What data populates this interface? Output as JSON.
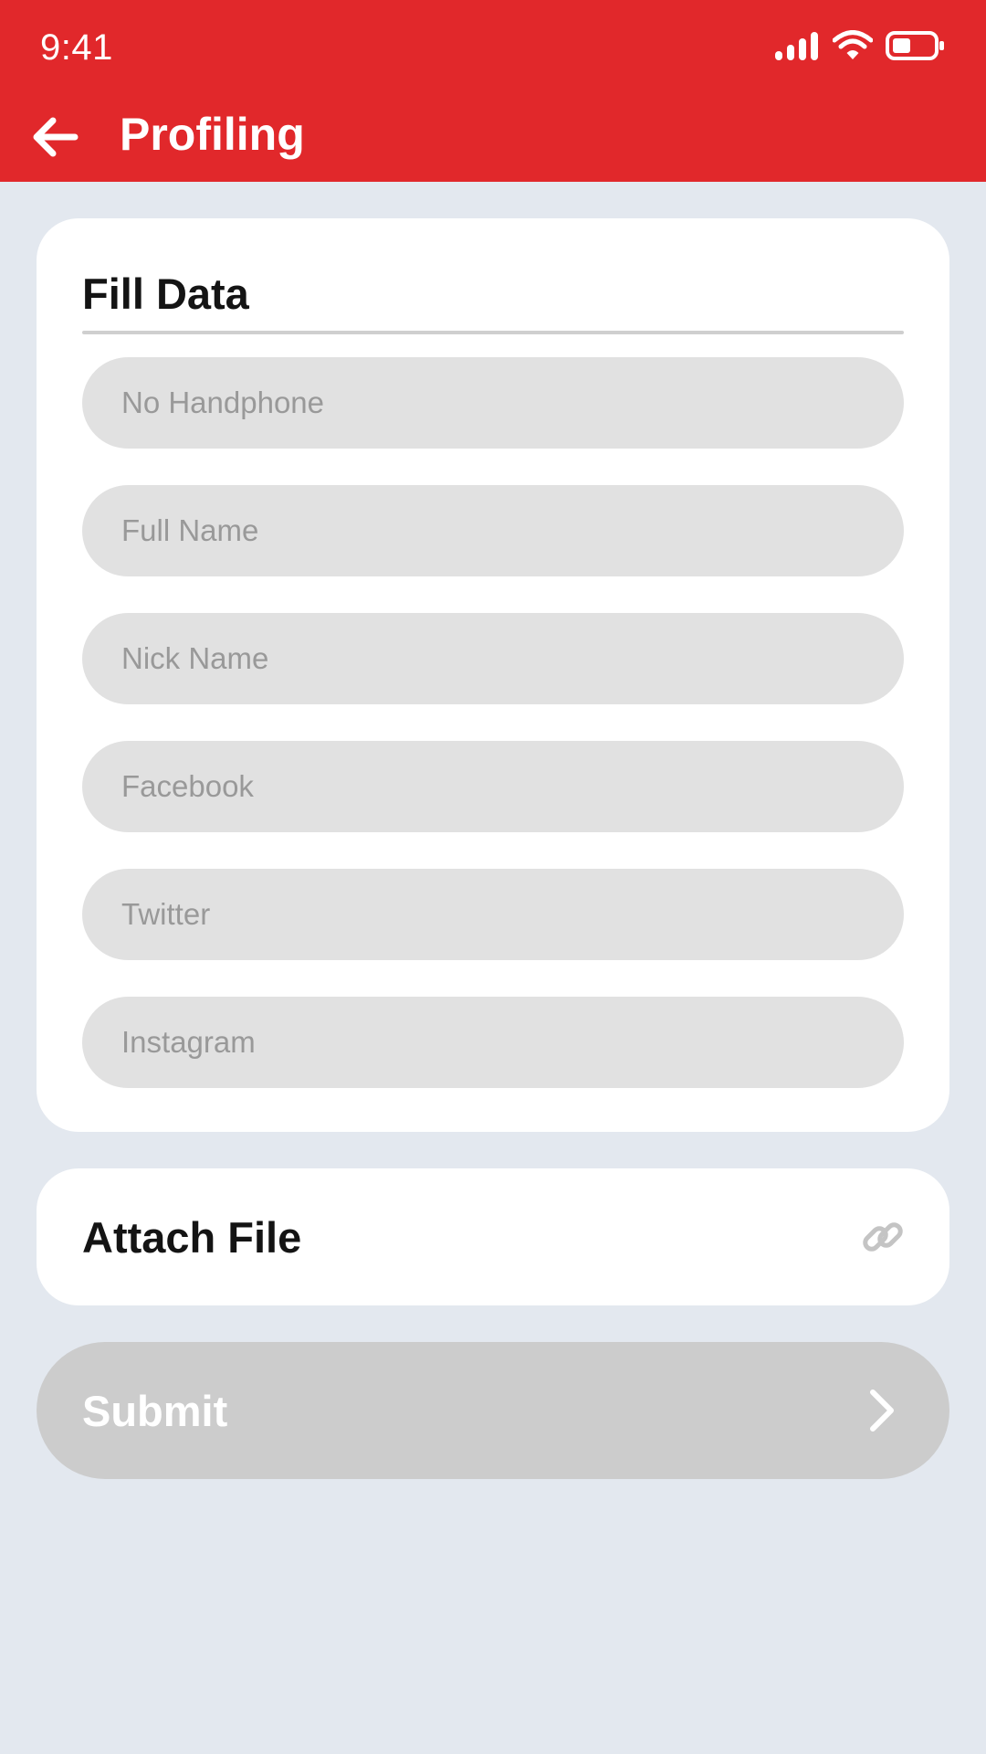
{
  "status_bar": {
    "time": "9:41",
    "icons": [
      "signal-icon",
      "wifi-icon",
      "battery-icon"
    ],
    "battery_level": 0.45
  },
  "app_bar": {
    "title": "Profiling",
    "back_icon": "arrow-left-icon",
    "color": "#e1282b"
  },
  "fill_data": {
    "heading": "Fill Data",
    "fields": [
      {
        "placeholder": "No Handphone",
        "value": ""
      },
      {
        "placeholder": "Full Name",
        "value": ""
      },
      {
        "placeholder": "Nick Name",
        "value": ""
      },
      {
        "placeholder": "Facebook",
        "value": ""
      },
      {
        "placeholder": "Twitter",
        "value": ""
      },
      {
        "placeholder": "Instagram",
        "value": ""
      }
    ]
  },
  "attach": {
    "label": "Attach File",
    "icon": "link-icon"
  },
  "submit": {
    "label": "Submit",
    "icon": "chevron-right-icon",
    "state": "disabled"
  }
}
